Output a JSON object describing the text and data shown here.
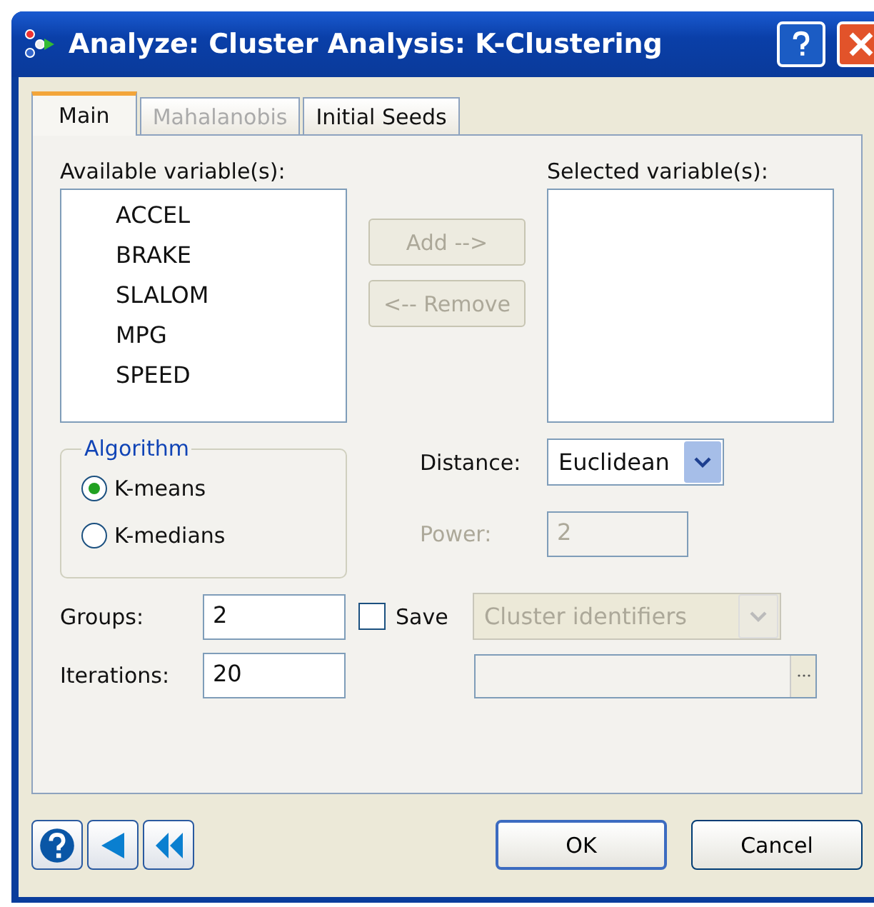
{
  "window": {
    "title": "Analyze: Cluster Analysis: K-Clustering"
  },
  "tabs": [
    {
      "label": "Main",
      "selected": true,
      "disabled": false
    },
    {
      "label": "Mahalanobis",
      "selected": false,
      "disabled": true
    },
    {
      "label": "Initial Seeds",
      "selected": false,
      "disabled": false
    }
  ],
  "available": {
    "label": "Available variable(s):",
    "items": [
      "ACCEL",
      "BRAKE",
      "SLALOM",
      "MPG",
      "SPEED"
    ]
  },
  "move_buttons": [
    {
      "label": "Add -->",
      "disabled": true
    },
    {
      "label": "<-- Remove",
      "disabled": true
    }
  ],
  "selected_list": {
    "label": "Selected variable(s):"
  },
  "algorithm": {
    "title": "Algorithm",
    "options": [
      {
        "label": "K-means",
        "selected": true
      },
      {
        "label": "K-medians",
        "selected": false
      }
    ]
  },
  "distance": {
    "label": "Distance:",
    "value": "Euclidean"
  },
  "power": {
    "label": "Power:",
    "value": "2",
    "disabled": true
  },
  "groups": {
    "label": "Groups:",
    "value": "2"
  },
  "iterations": {
    "label": "Iterations:",
    "value": "20"
  },
  "save": {
    "label": "Save",
    "checked": false,
    "value": "Cluster identifiers",
    "disabled": true
  },
  "buttons": [
    "OK",
    "Cancel"
  ]
}
